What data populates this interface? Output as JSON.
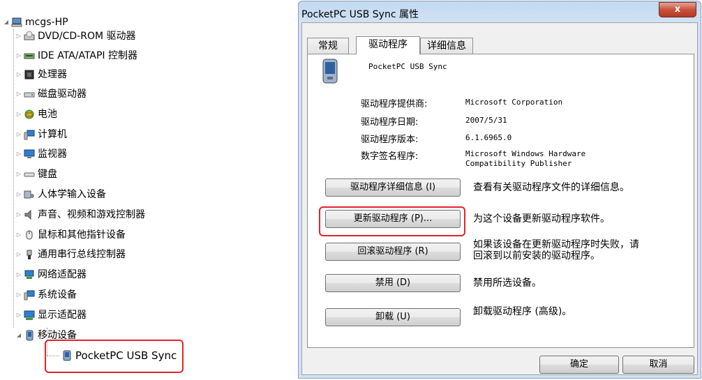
{
  "tree": {
    "root": "mcgs-HP",
    "items": [
      {
        "label": "DVD/CD-ROM 驱动器",
        "icon": "dvd-drive-icon"
      },
      {
        "label": "IDE ATA/ATAPI 控制器",
        "icon": "ide-controller-icon"
      },
      {
        "label": "处理器",
        "icon": "processor-icon"
      },
      {
        "label": "磁盘驱动器",
        "icon": "disk-drive-icon"
      },
      {
        "label": "电池",
        "icon": "battery-icon"
      },
      {
        "label": "计算机",
        "icon": "computer-icon"
      },
      {
        "label": "监视器",
        "icon": "monitor-icon"
      },
      {
        "label": "键盘",
        "icon": "keyboard-icon"
      },
      {
        "label": "人体学输入设备",
        "icon": "hid-icon"
      },
      {
        "label": "声音、视频和游戏控制器",
        "icon": "speaker-icon"
      },
      {
        "label": "鼠标和其他指针设备",
        "icon": "mouse-icon"
      },
      {
        "label": "通用串行总线控制器",
        "icon": "usb-icon"
      },
      {
        "label": "网络适配器",
        "icon": "network-icon"
      },
      {
        "label": "系统设备",
        "icon": "system-device-icon"
      },
      {
        "label": "显示适配器",
        "icon": "display-adapter-icon"
      },
      {
        "label": "移动设备",
        "icon": "mobile-device-icon"
      }
    ],
    "child": "PocketPC USB Sync"
  },
  "dialog": {
    "title": "PocketPC USB Sync 属性",
    "close": "x",
    "tabs": [
      "常规",
      "驱动程序",
      "详细信息"
    ],
    "device_name": "PocketPC USB Sync",
    "props": [
      {
        "label": "驱动程序提供商:",
        "value": "Microsoft Corporation"
      },
      {
        "label": "驱动程序日期:",
        "value": "2007/5/31"
      },
      {
        "label": "驱动程序版本:",
        "value": "6.1.6965.0"
      },
      {
        "label": "数字签名程序:",
        "value": "Microsoft Windows Hardware\nCompatibility Publisher"
      }
    ],
    "actions": [
      {
        "button": "驱动程序详细信息 (I)",
        "desc": "查看有关驱动程序文件的详细信息。"
      },
      {
        "button": "更新驱动程序 (P)...",
        "desc": "为这个设备更新驱动程序软件。"
      },
      {
        "button": "回滚驱动程序 (R)",
        "desc": "如果该设备在更新驱动程序时失败，请\n回滚到以前安装的驱动程序。"
      },
      {
        "button": "禁用 (D)",
        "desc": "禁用所选设备。"
      },
      {
        "button": "卸载 (U)",
        "desc": "卸载驱动程序 (高级)。"
      }
    ],
    "ok": "确定",
    "cancel": "取消"
  },
  "colors": {
    "highlight": "#e2242a",
    "titlebar": "#c8dcf0",
    "close": "#c8513b"
  }
}
